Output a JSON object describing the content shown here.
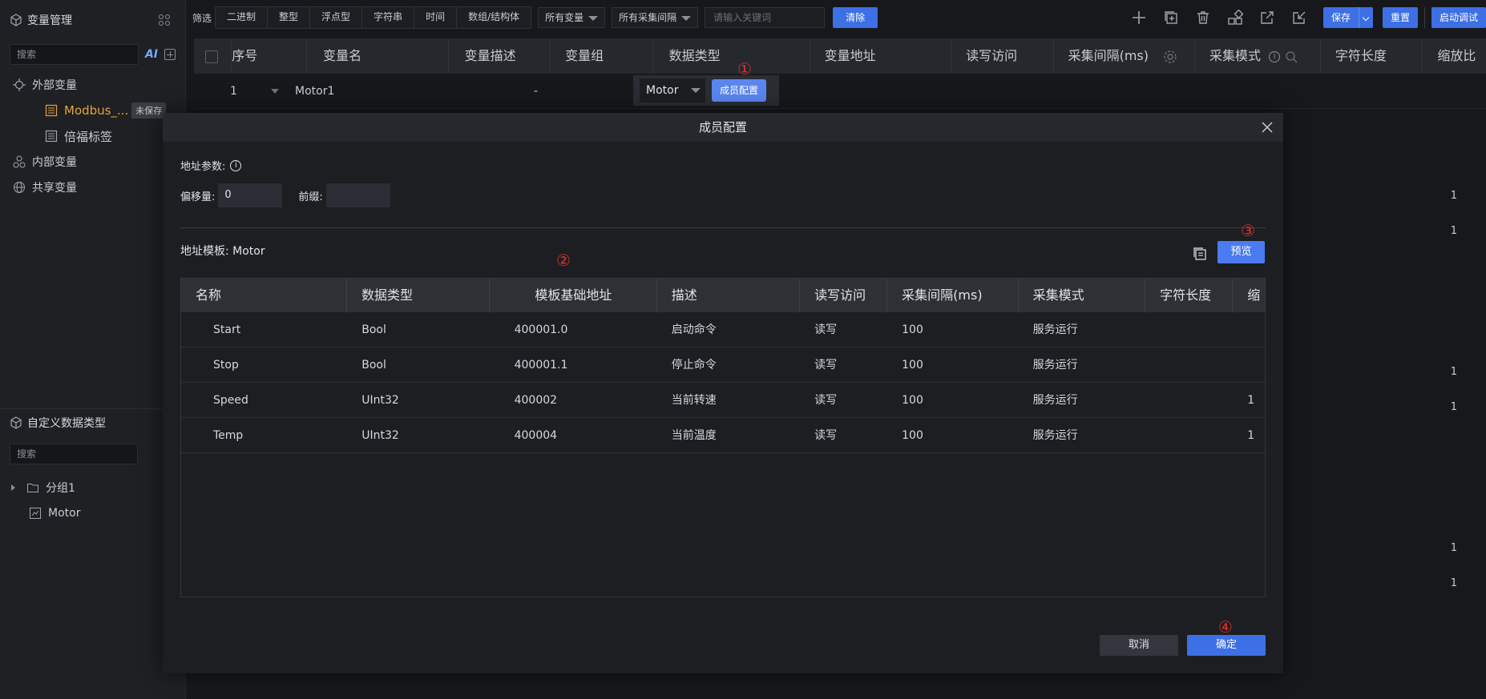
{
  "sidebar": {
    "title": "变量管理",
    "search_placeholder": "搜索",
    "ai_label": "AI",
    "tree": [
      {
        "label": "外部变量"
      },
      {
        "label": "Modbus_...",
        "badge": "未保存"
      },
      {
        "label": "倍福标签"
      },
      {
        "label": "内部变量"
      },
      {
        "label": "共享变量"
      }
    ],
    "custom_types": {
      "title": "自定义数据类型",
      "search_placeholder": "搜索",
      "items": [
        {
          "label": "分组1"
        },
        {
          "label": "Motor"
        }
      ]
    }
  },
  "toolbar": {
    "filter_label": "筛选",
    "filter_types": [
      "二进制",
      "整型",
      "浮点型",
      "字符串",
      "时间",
      "数组/结构体"
    ],
    "var_filter": "所有变量",
    "interval_filter": "所有采集间隔",
    "keyword_placeholder": "请输入关键词",
    "clear_label": "清除",
    "save_label": "保存",
    "reset_label": "重置",
    "debug_label": "启动调试"
  },
  "main_table": {
    "columns": [
      "序号",
      "变量名",
      "变量描述",
      "变量组",
      "数据类型",
      "变量地址",
      "读写访问",
      "采集间隔(ms)",
      "采集模式",
      "字符长度",
      "缩放比"
    ],
    "row": {
      "index": "1",
      "name": "Motor1",
      "group": "-",
      "type": "Motor",
      "member_btn": "成员配置"
    },
    "right_values": [
      "1",
      "1",
      "1",
      "1",
      "1",
      "1"
    ]
  },
  "markers": [
    "①",
    "②",
    "③",
    "④"
  ],
  "modal": {
    "title": "成员配置",
    "addr_params_label": "地址参数:",
    "offset_label": "偏移量:",
    "offset_value": "0",
    "prefix_label": "前缀:",
    "prefix_value": "",
    "template_label": "地址模板:  Motor",
    "preview_label": "预览",
    "columns": [
      "名称",
      "数据类型",
      "模板基础地址",
      "描述",
      "读写访问",
      "采集间隔(ms)",
      "采集模式",
      "字符长度",
      "缩"
    ],
    "rows": [
      {
        "name": "Start",
        "type": "Bool",
        "addr": "400001.0",
        "desc": "启动命令",
        "rw": "读写",
        "interval": "100",
        "mode": "服务运行",
        "len": "",
        "scale": ""
      },
      {
        "name": "Stop",
        "type": "Bool",
        "addr": "400001.1",
        "desc": "停止命令",
        "rw": "读写",
        "interval": "100",
        "mode": "服务运行",
        "len": "",
        "scale": ""
      },
      {
        "name": "Speed",
        "type": "UInt32",
        "addr": "400002",
        "desc": "当前转速",
        "rw": "读写",
        "interval": "100",
        "mode": "服务运行",
        "len": "",
        "scale": "1"
      },
      {
        "name": "Temp",
        "type": "UInt32",
        "addr": "400004",
        "desc": "当前温度",
        "rw": "读写",
        "interval": "100",
        "mode": "服务运行",
        "len": "",
        "scale": "1"
      }
    ],
    "cancel_label": "取消",
    "ok_label": "确定"
  }
}
